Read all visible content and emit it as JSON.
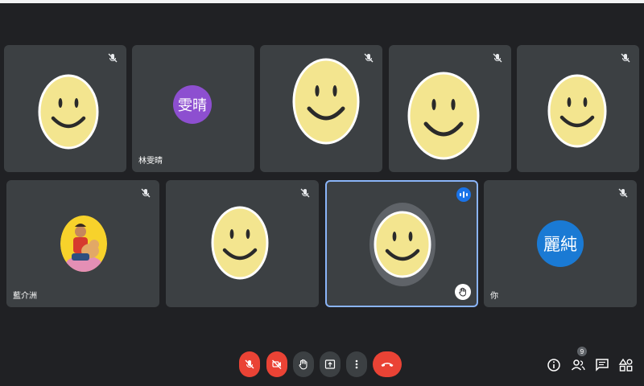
{
  "participants": [
    {
      "name": "",
      "type": "smiley",
      "muted": true
    },
    {
      "name": "林雯晴",
      "type": "initials",
      "initials": "雯晴",
      "color": "#8d4fd0",
      "muted": false
    },
    {
      "name": "",
      "type": "smiley",
      "muted": true
    },
    {
      "name": "",
      "type": "smiley",
      "muted": true
    },
    {
      "name": "",
      "type": "smiley",
      "muted": true
    },
    {
      "name": "藍介洲",
      "type": "photo",
      "muted": true
    },
    {
      "name": "",
      "type": "smiley",
      "muted": true
    },
    {
      "name": "",
      "type": "smiley",
      "speaking": true,
      "hand_raised": true,
      "active": true
    },
    {
      "name": "你",
      "type": "initials",
      "initials": "麗純",
      "color": "#1a7ad4",
      "muted": true
    }
  ],
  "controls": [
    "mic-off",
    "camera-off",
    "raise-hand",
    "present",
    "more-options",
    "leave-call"
  ],
  "side_controls": {
    "people_count": "9"
  },
  "colors": {
    "background": "#202124",
    "tile": "#3c4043",
    "danger": "#ea4335",
    "active_border": "#8ab4f8",
    "smiley_fill": "#f3e58f"
  }
}
